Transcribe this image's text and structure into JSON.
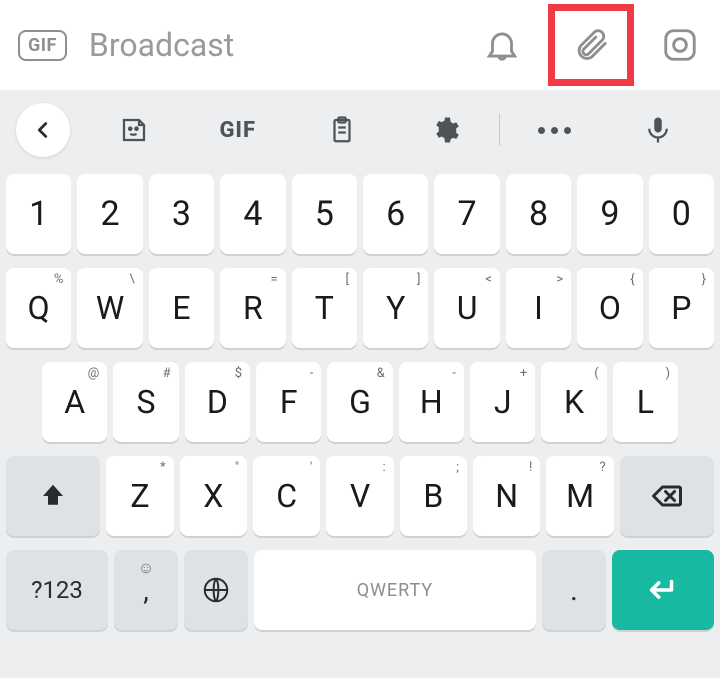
{
  "input_bar": {
    "gif_label": "GIF",
    "placeholder": "Broadcast"
  },
  "keyboard": {
    "toolbar_gif_label": "GIF",
    "rows": {
      "numbers": [
        "1",
        "2",
        "3",
        "4",
        "5",
        "6",
        "7",
        "8",
        "9",
        "0"
      ],
      "row2": [
        {
          "k": "Q",
          "h": "%"
        },
        {
          "k": "W",
          "h": "\\"
        },
        {
          "k": "E",
          "h": ""
        },
        {
          "k": "R",
          "h": "="
        },
        {
          "k": "T",
          "h": "["
        },
        {
          "k": "Y",
          "h": "]"
        },
        {
          "k": "U",
          "h": "<"
        },
        {
          "k": "I",
          "h": ">"
        },
        {
          "k": "O",
          "h": "{"
        },
        {
          "k": "P",
          "h": "}"
        }
      ],
      "row3": [
        {
          "k": "A",
          "h": "@"
        },
        {
          "k": "S",
          "h": "#"
        },
        {
          "k": "D",
          "h": "$"
        },
        {
          "k": "F",
          "h": "-"
        },
        {
          "k": "G",
          "h": "&"
        },
        {
          "k": "H",
          "h": "-"
        },
        {
          "k": "J",
          "h": "+"
        },
        {
          "k": "K",
          "h": "("
        },
        {
          "k": "L",
          "h": ")"
        }
      ],
      "row4": [
        {
          "k": "Z",
          "h": "*"
        },
        {
          "k": "X",
          "h": "\""
        },
        {
          "k": "C",
          "h": "'"
        },
        {
          "k": "V",
          "h": ":"
        },
        {
          "k": "B",
          "h": ";"
        },
        {
          "k": "N",
          "h": "!"
        },
        {
          "k": "M",
          "h": "?"
        }
      ]
    },
    "symbols_label": "?123",
    "space_label": "QWERTY",
    "comma_label": ",",
    "period_label": "."
  }
}
